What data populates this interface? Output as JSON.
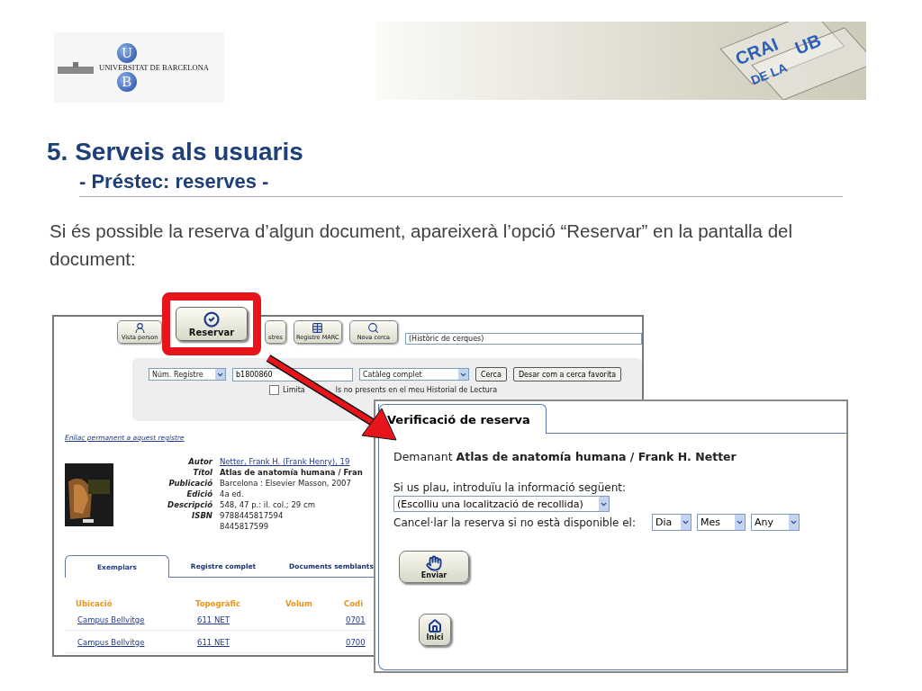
{
  "header": {
    "university_logo": {
      "letters": [
        "U",
        "B"
      ],
      "name": "UNIVERSITAT DE BARCELONA"
    },
    "banner_logo": {
      "lines": [
        "CRAI",
        "DE LA",
        "UB"
      ]
    }
  },
  "title": "5. Serveis als usuaris",
  "subtitle": "- Préstec: reserves -",
  "body": "Si és possible la reserva d’algun document, apareixerà l’opció “Reservar” en la pantalla del document:",
  "catalog_screenshot": {
    "toolbar": [
      {
        "kind": "profile",
        "label": "Vista person"
      },
      {
        "kind": "partial",
        "label": "stres"
      },
      {
        "kind": "marc",
        "label": "Registre MARC"
      },
      {
        "kind": "search",
        "label": "Nova cerca"
      }
    ],
    "highlighted_button": {
      "label": "Reservar"
    },
    "history_select": {
      "value": "(Històric de cerques)"
    },
    "search": {
      "field_select": {
        "value": "Núm. Registre"
      },
      "query": {
        "value": "b1800860"
      },
      "catalog_select": {
        "value": "Catàleg complet"
      },
      "buttons": [
        "Cerca",
        "Desar com a cerca favorita"
      ],
      "limit_option": {
        "checked": false,
        "label_start": "Limita",
        "label_end": "ls no presents en el meu Historial de Lectura"
      }
    },
    "permalink": "Enllaç permanent a aquest registre",
    "record": [
      {
        "label": "Autor",
        "value": "Netter, Frank H. (Frank Henry), 19",
        "kind": "link"
      },
      {
        "label": "Títol",
        "value": "Atlas de anatomía humana / Fran",
        "kind": "bold"
      },
      {
        "label": "Publicació",
        "value": "Barcelona : Elsevier Masson, 2007",
        "kind": "plain"
      },
      {
        "label": "Edició",
        "value": "4a ed.",
        "kind": "plain"
      },
      {
        "label": "Descripció",
        "value": "548, 47 p.: il. col.; 29 cm",
        "kind": "plain"
      },
      {
        "label": "ISBN",
        "value": "9788445817594",
        "kind": "plain"
      },
      {
        "value": "8445817599",
        "kind": "plain"
      }
    ],
    "tabs": [
      {
        "label": "Exemplars",
        "selected": true
      },
      {
        "label": "Registre complet",
        "selected": false
      },
      {
        "label": "Documents semblants",
        "selected": false
      }
    ],
    "table": {
      "columns": [
        "Ubicació",
        "Topogràfic",
        "Volum",
        "Codi"
      ],
      "rows": [
        [
          "Campus Bellvitge",
          "611 NET",
          "",
          "0701"
        ],
        [
          "Campus Bellvitge",
          "611 NET",
          "",
          "0700"
        ]
      ]
    }
  },
  "dialog": {
    "tab": "Verificació de reserva",
    "request": "Demanant **Atlas de anatomía humana / Frank H. Netter**",
    "prompt": "Si us plau, introduïu la informació següent:",
    "pickup_select": {
      "value": "(Escolliu una localització de recollida)"
    },
    "cancel_label": "Cancel·lar la reserva si no està disponible el:",
    "date_selects": [
      "Dia",
      "Mes",
      "Any"
    ],
    "submit": "Enviar",
    "home": "Inici"
  }
}
